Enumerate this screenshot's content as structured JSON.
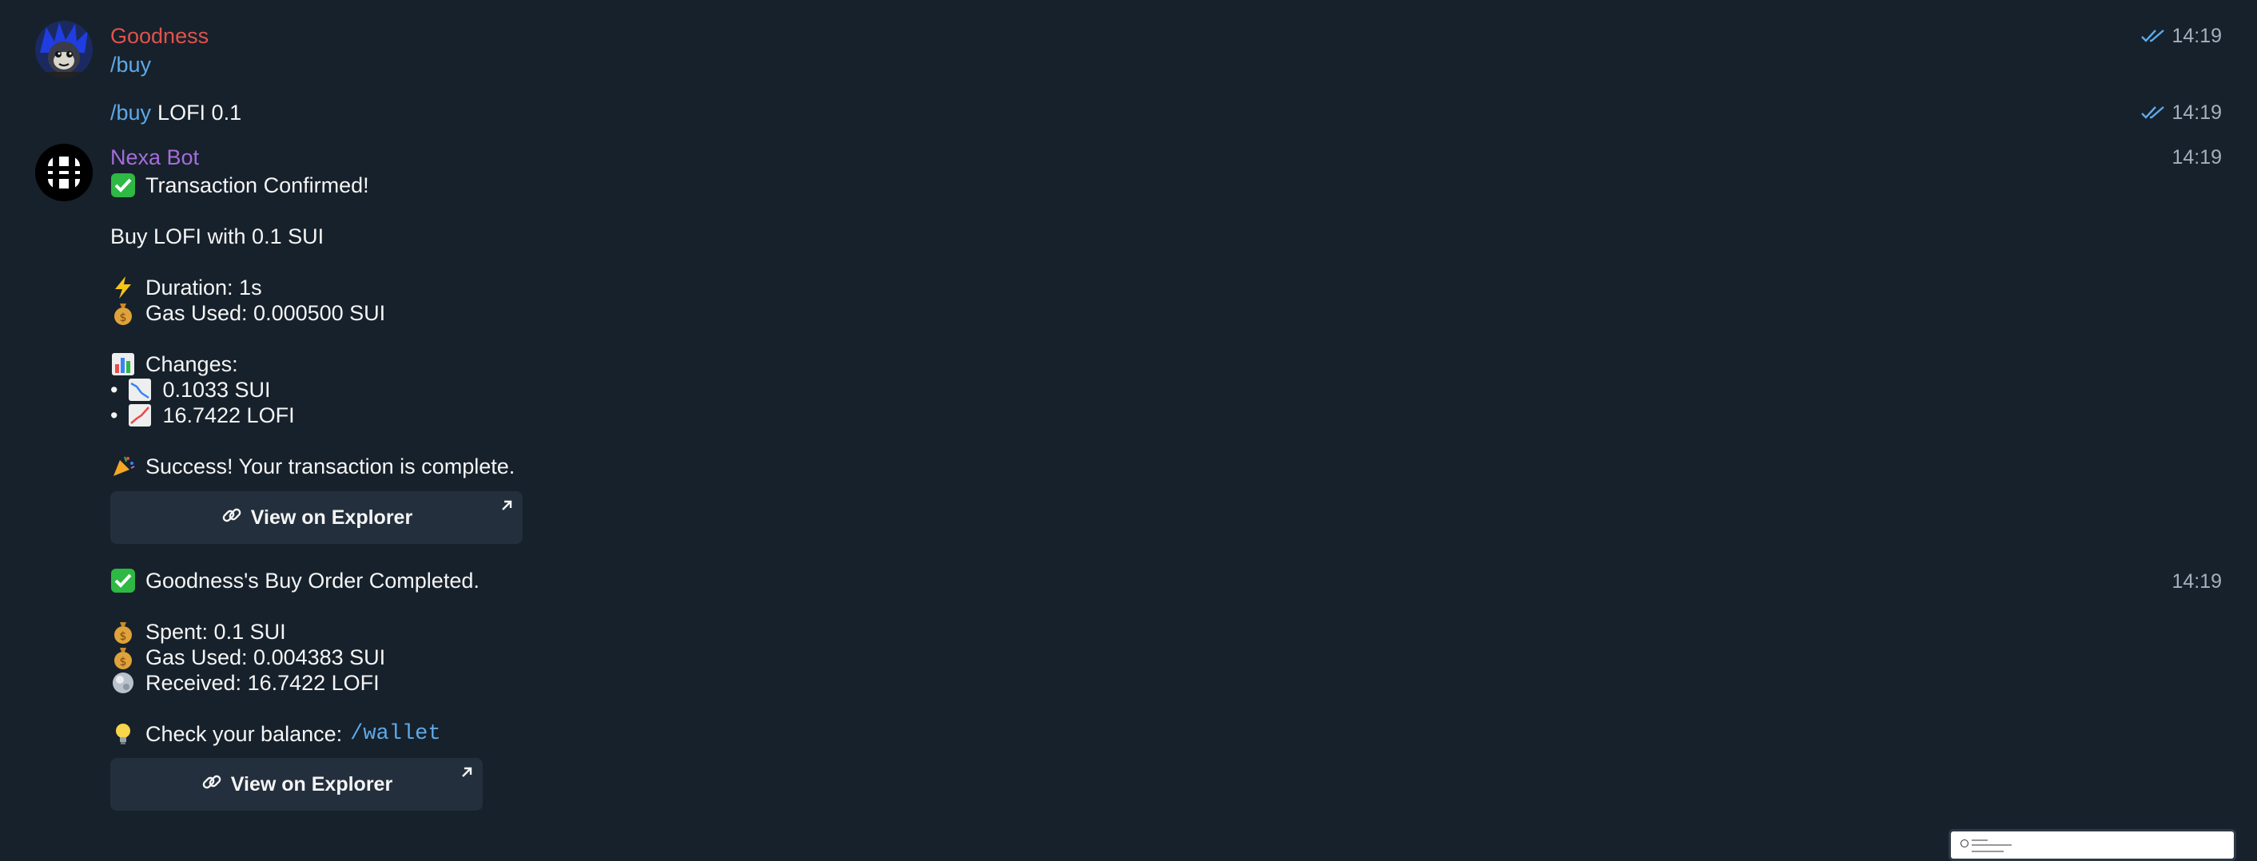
{
  "colors": {
    "background": "#17212b",
    "user_name": "#e0534c",
    "bot_name": "#a56ddb",
    "command": "#5ea9ea",
    "button_bg": "#232f3d",
    "timestamp": "#a5b0bc"
  },
  "messages": {
    "user": {
      "name": "Goodness",
      "avatar_icon": "blue-haired-character-avatar",
      "command": "/buy",
      "time": "14:19",
      "followup_command": "/buy",
      "followup_args": "LOFI 0.1",
      "followup_time": "14:19"
    },
    "bot": {
      "name": "Nexa Bot",
      "avatar_icon": "nexa-logo-avatar",
      "time": "14:19",
      "header_emoji": "check-mark-icon",
      "header": "Transaction Confirmed!",
      "summary": "Buy LOFI with 0.1 SUI",
      "duration_emoji": "lightning-icon",
      "duration": "Duration: 1s",
      "gas_emoji": "money-bag-icon",
      "gas": "Gas Used: 0.000500 SUI",
      "changes_emoji": "bar-chart-icon",
      "changes_title": "Changes:",
      "changes": [
        {
          "bullet": "•",
          "icon": "chart-decreasing-icon",
          "text": "0.1033 SUI"
        },
        {
          "bullet": "•",
          "icon": "chart-increasing-icon",
          "text": "16.7422 LOFI"
        }
      ],
      "success_emoji": "party-popper-icon",
      "success": "Success! Your transaction is complete.",
      "button_label": "View on Explorer"
    },
    "order": {
      "time": "14:19",
      "header_emoji": "check-mark-icon",
      "header": "Goodness's Buy Order Completed.",
      "spent_emoji": "money-bag-icon",
      "spent": "Spent: 0.1 SUI",
      "gas_emoji": "money-bag-icon",
      "gas": "Gas Used: 0.004383 SUI",
      "received_emoji": "globe-icon",
      "received": "Received: 16.7422 LOFI",
      "balance_emoji": "light-bulb-icon",
      "balance_prefix": "Check your balance:",
      "balance_command": "/wallet",
      "button_label": "View on Explorer"
    }
  }
}
